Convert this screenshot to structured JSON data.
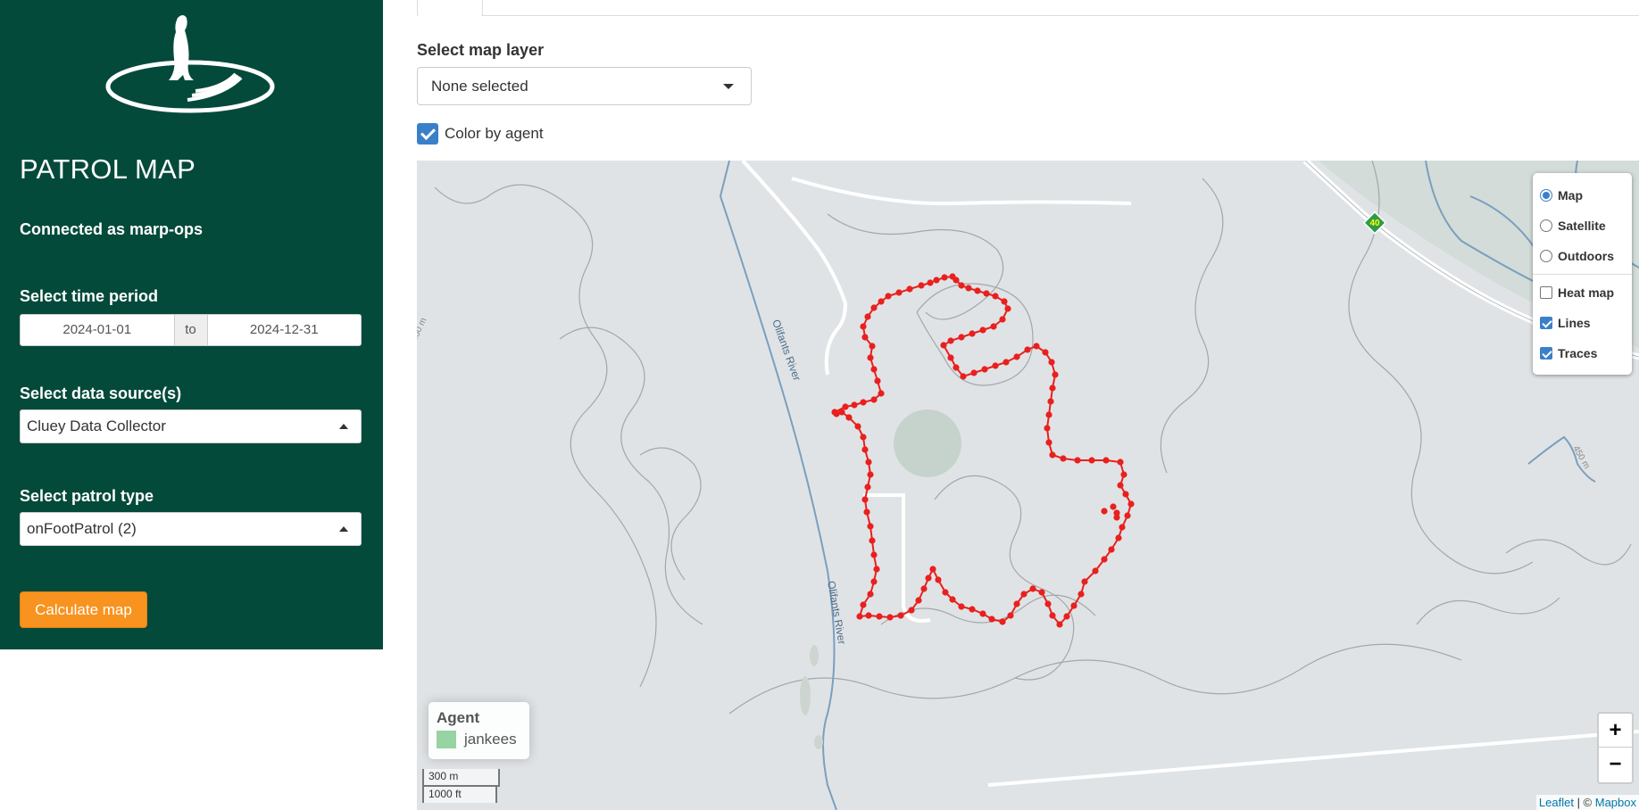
{
  "sidebar": {
    "title": "PATROL MAP",
    "connected": "Connected as marp-ops",
    "time_label": "Select time period",
    "date_from": "2024-01-01",
    "date_sep": "to",
    "date_to": "2024-12-31",
    "source_label": "Select data source(s)",
    "source_value": "Cluey Data Collector",
    "patrol_label": "Select patrol type",
    "patrol_value": "onFootPatrol (2)",
    "calc_button": "Calculate map"
  },
  "main": {
    "layer_label": "Select map layer",
    "layer_value": "None selected",
    "color_by_agent": "Color by agent"
  },
  "map": {
    "layers": {
      "map": "Map",
      "satellite": "Satellite",
      "outdoors": "Outdoors"
    },
    "overlays": {
      "heat": "Heat map",
      "lines": "Lines",
      "traces": "Traces"
    },
    "selected_base": "Map",
    "overlays_checked": [
      "Lines",
      "Traces"
    ],
    "legend_title": "Agent",
    "legend_agent": "jankees",
    "legend_color": "#98d3a4",
    "track_color": "#e8201e",
    "river_name": "Olifants River",
    "road_shield": "40",
    "contour_label": "450 m",
    "contour_label_2": "450 m",
    "zoom_in": "+",
    "zoom_out": "−",
    "scale_metric": "300 m",
    "scale_imperial": "1000 ft",
    "attrib_leaflet": "Leaflet",
    "attrib_sep": " | © ",
    "attrib_mapbox": "Mapbox"
  }
}
